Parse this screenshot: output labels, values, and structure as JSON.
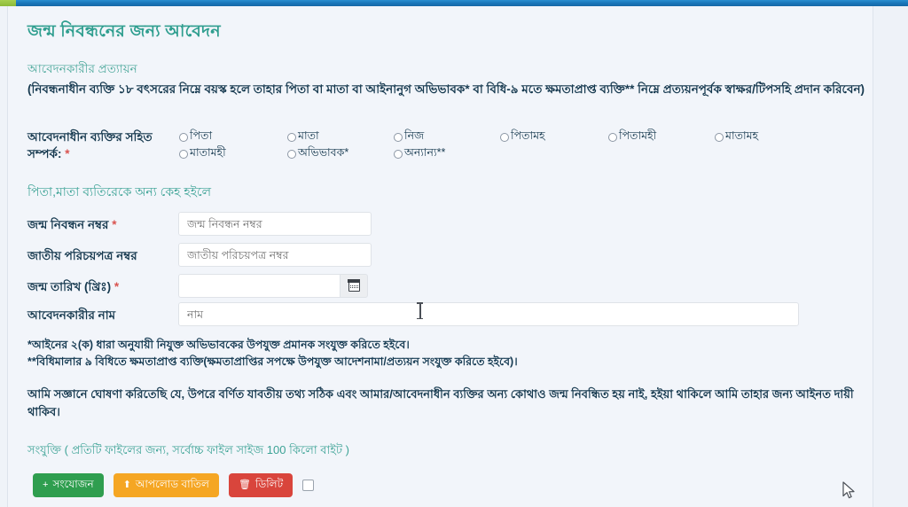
{
  "topbar": {
    "bar_color": "#1b78bb",
    "progress_color": "#8cba38"
  },
  "page": {
    "title": "জন্ম নিবন্ধনের জন্য আবেদন",
    "subhead": "আবেদনকারীর প্রত্যায়ন",
    "intro_paragraph": "(নিবন্ধনাধীন ব্যক্তি ১৮ বৎসরের নিম্নে বয়স্ক হলে তাহার পিতা বা মাতা বা আইনানুগ অভিভাবক* বা বিধি-৯ মতে ক্ষমতাপ্রাপ্ত ব্যক্তি** নিম্নে প্রত্যয়নপূর্বক স্বাক্ষর/টিপসহি প্রদান করিবেন)",
    "section_head": "পিতা,মাতা ব্যতিরেকে অন্য কেহ হইলে",
    "accent_color": "#2f9e8f"
  },
  "relation": {
    "label": "আবেদনাধীন ব্যক্তির সহিত সম্পর্ক:",
    "required_mark": "*",
    "options_row1": [
      "পিতা",
      "মাতা",
      "নিজ",
      "পিতামহ",
      "পিতামহী",
      "মাতামহ"
    ],
    "options_row2": [
      "মাতামহী",
      "অভিভাবক*",
      "অন্যান্য**"
    ]
  },
  "form": {
    "birth_reg": {
      "label": "জন্ম নিবন্ধন নম্বর",
      "required_mark": "*",
      "placeholder": "জন্ম নিবন্ধন নম্বর",
      "value": ""
    },
    "nid": {
      "label": "জাতীয় পরিচয়পত্র নম্বর",
      "placeholder": "জাতীয় পরিচয়পত্র নম্বর",
      "value": ""
    },
    "dob": {
      "label": "জন্ম তারিখ (খ্রিঃ)",
      "required_mark": "*",
      "placeholder": "",
      "value": "",
      "calendar_icon": "calendar-icon"
    },
    "applicant_name": {
      "label": "আবেদনকারীর নাম",
      "placeholder": "নাম",
      "value": ""
    }
  },
  "footnotes": {
    "one": "*আইনের ২(ক) ধারা অনুযায়ী নিযুক্ত অভিভাবকের উপযুক্ত প্রমানক সংযুক্ত করিতে হইবে।",
    "two": "**বিধিমালার ৯ বিধিতে ক্ষমতাপ্রাপ্ত ব্যক্তি(ক্ষমতাপ্রাপ্তির সপক্ষে উপযুক্ত আদেশনামা/প্রত্যয়ন সংযুক্ত করিতে হইবে)।"
  },
  "declaration": "আমি সজ্ঞানে ঘোষণা করিতেছি যে, উপরে বর্ণিত যাবতীয় তথ্য সঠিক এবং আমার/আবেদনাধীন ব্যক্তির অন্য কোথাও জন্ম নিবন্ধিত হয় নাই, হইয়া থাকিলে আমি তাহার জন্য আইনত দায়ী থাকিব।",
  "attachment": {
    "heading": "সংযুক্তি ( প্রতিটি ফাইলের জন্য, সর্বোচ্চ ফাইল সাইজ 100 কিলো বাইট )",
    "buttons": [
      {
        "name": "add",
        "icon": "+",
        "label": "সংযোজন",
        "color": "#2f9e4f"
      },
      {
        "name": "upload_cancel",
        "icon": "⬆",
        "label": "আপলোড বাতিল",
        "color": "#f5a623"
      },
      {
        "name": "delete",
        "icon": "🗑",
        "label": "ডিলিট",
        "color": "#d9453c"
      }
    ],
    "select_checkbox": "file-select-checkbox"
  },
  "cursors": {
    "mouse_pointer": "arrow-cursor",
    "text_caret": "ibeam-cursor"
  }
}
